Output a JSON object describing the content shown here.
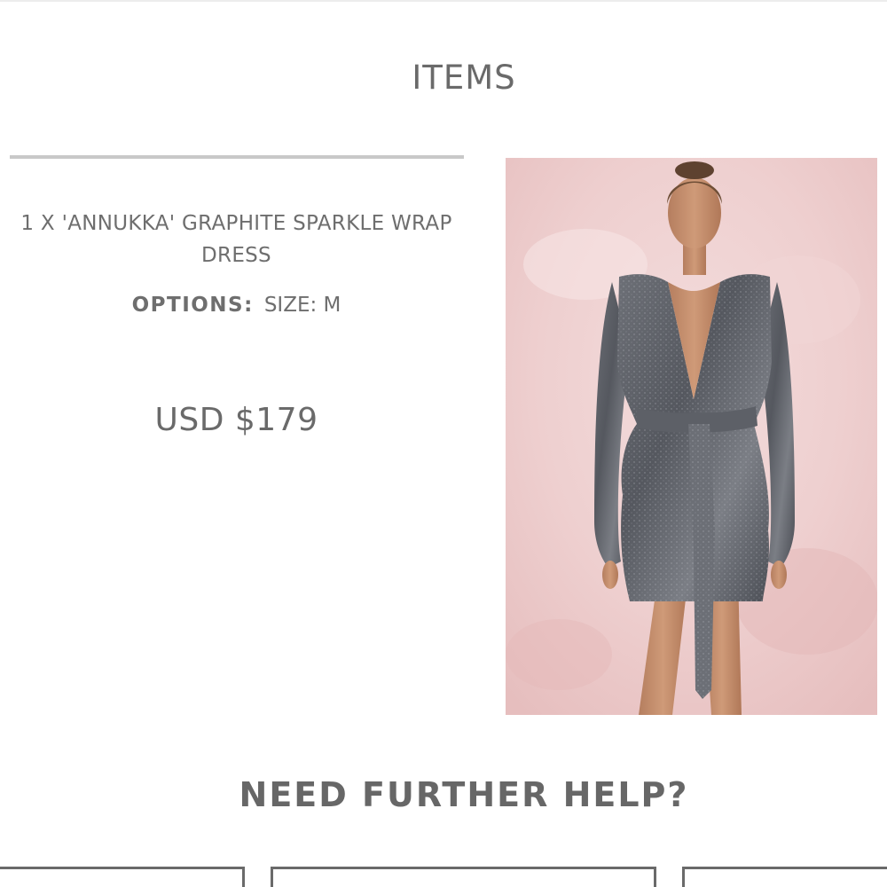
{
  "section": {
    "title": "ITEMS"
  },
  "item": {
    "name": "1 X 'ANNUKKA' GRAPHITE SPARKLE WRAP DRESS",
    "options_label": "OPTIONS:",
    "options_value": "SIZE: M",
    "price": "USD $179"
  },
  "help": {
    "title": "NEED FURTHER HELP?"
  }
}
